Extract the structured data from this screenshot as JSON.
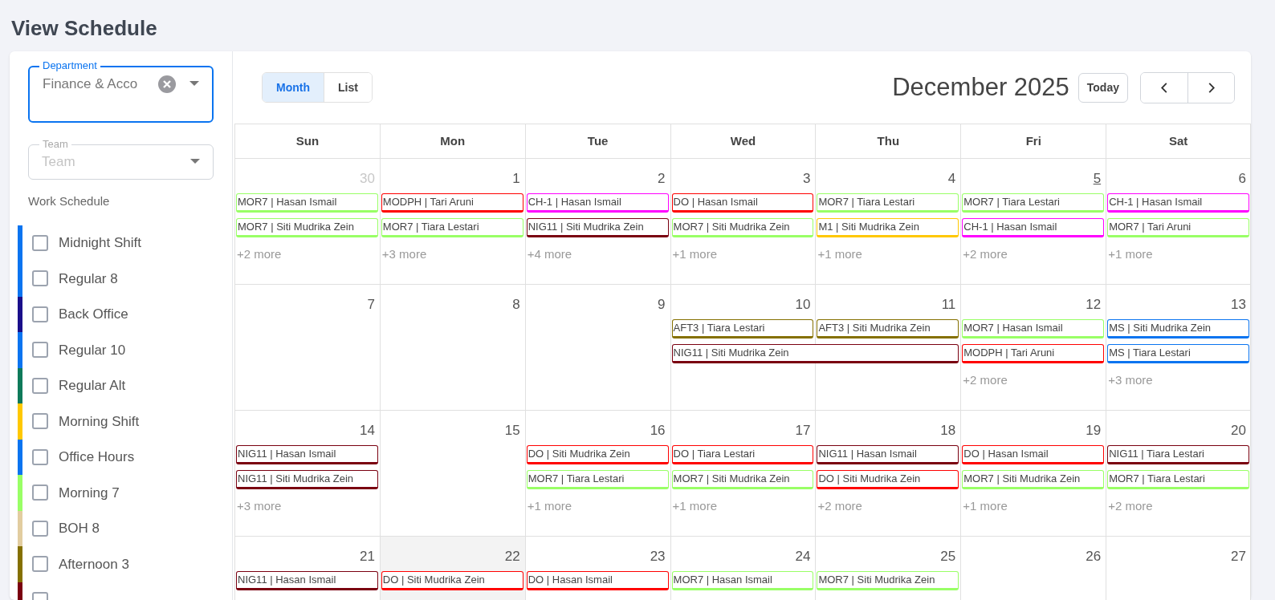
{
  "page_title": "View Schedule",
  "filters": {
    "department": {
      "label": "Department",
      "value": "Finance & Acco"
    },
    "team": {
      "label": "Team",
      "placeholder": "Team"
    },
    "work_schedule_label": "Work Schedule"
  },
  "schedules": [
    {
      "label": "Midnight Shift",
      "color": "#0a74f0",
      "checked": false
    },
    {
      "label": "Regular 8",
      "color": "#0a74f0",
      "checked": false
    },
    {
      "label": "Back Office",
      "color": "#1a0f8a",
      "checked": false
    },
    {
      "label": "Regular 10",
      "color": "#0a74f0",
      "checked": false
    },
    {
      "label": "Regular Alt",
      "color": "#0f7a5a",
      "checked": false
    },
    {
      "label": "Morning Shift",
      "color": "#ffc800",
      "checked": false
    },
    {
      "label": "Office Hours",
      "color": "#0a74f0",
      "checked": false
    },
    {
      "label": "Morning 7",
      "color": "#99ff66",
      "checked": false
    },
    {
      "label": "BOH 8",
      "color": "#e2cda0",
      "checked": false
    },
    {
      "label": "Afternoon 3",
      "color": "#857000",
      "checked": false
    },
    {
      "color": "#7a0010",
      "checked": false
    }
  ],
  "view_tabs": [
    {
      "label": "Month",
      "selected": true
    },
    {
      "label": "List",
      "selected": false
    }
  ],
  "calendar_title": "December 2025",
  "today_button": "Today",
  "weekdays": [
    "Sun",
    "Mon",
    "Tue",
    "Wed",
    "Thu",
    "Fri",
    "Sat"
  ],
  "weeks": [
    {
      "days": [
        {
          "date": "30",
          "outside_month": true,
          "today": false,
          "selected": false,
          "more": "+2 more",
          "events": [
            {
              "label": "MOR7 | Hasan Ismail",
              "color": "#99ff66"
            },
            {
              "label": "MOR7 | Siti Mudrika Zein",
              "color": "#99ff66"
            }
          ]
        },
        {
          "date": "1",
          "outside_month": false,
          "today": false,
          "selected": false,
          "more": "+3 more",
          "events": [
            {
              "label": "MODPH | Tari Aruni",
              "color": "#ff0000"
            },
            {
              "label": "MOR7 | Tiara Lestari",
              "color": "#99ff66"
            }
          ]
        },
        {
          "date": "2",
          "outside_month": false,
          "today": false,
          "selected": false,
          "more": "+4 more",
          "events": [
            {
              "label": "CH-1 | Hasan Ismail",
              "color": "#ff00ff"
            },
            {
              "label": "NIG11 | Siti Mudrika Zein",
              "color": "#7a0010"
            }
          ]
        },
        {
          "date": "3",
          "outside_month": false,
          "today": false,
          "selected": false,
          "more": "+1 more",
          "events": [
            {
              "label": "DO | Hasan Ismail",
              "color": "#ff0000"
            },
            {
              "label": "MOR7 | Siti Mudrika Zein",
              "color": "#99ff66"
            }
          ]
        },
        {
          "date": "4",
          "outside_month": false,
          "today": false,
          "selected": false,
          "more": "+1 more",
          "events": [
            {
              "label": "MOR7 | Tiara Lestari",
              "color": "#99ff66"
            },
            {
              "label": "M1 | Siti Mudrika Zein",
              "color": "#ffc800"
            }
          ]
        },
        {
          "date": "5",
          "outside_month": false,
          "today": true,
          "selected": false,
          "more": "+2 more",
          "events": [
            {
              "label": "MOR7 | Tiara Lestari",
              "color": "#99ff66"
            },
            {
              "label": "CH-1 | Hasan Ismail",
              "color": "#ff00ff"
            }
          ]
        },
        {
          "date": "6",
          "outside_month": false,
          "today": false,
          "selected": false,
          "more": "+1 more",
          "events": [
            {
              "label": "CH-1 | Hasan Ismail",
              "color": "#ff00ff"
            },
            {
              "label": "MOR7 | Tari Aruni",
              "color": "#99ff66"
            }
          ]
        }
      ]
    },
    {
      "days": [
        {
          "date": "7",
          "outside_month": false,
          "today": false,
          "selected": false
        },
        {
          "date": "8",
          "outside_month": false,
          "today": false,
          "selected": false
        },
        {
          "date": "9",
          "outside_month": false,
          "today": false,
          "selected": false
        },
        {
          "date": "10",
          "outside_month": false,
          "today": false,
          "selected": false,
          "events": [
            {
              "label": "AFT3 | Tiara Lestari",
              "color": "#857000"
            },
            {
              "label": "NIG11 | Siti Mudrika Zein",
              "color": "#7a0010",
              "continues_next_day": true
            }
          ]
        },
        {
          "date": "11",
          "outside_month": false,
          "today": false,
          "selected": false,
          "events": [
            {
              "label": "AFT3 | Siti Mudrika Zein",
              "color": "#857000"
            }
          ]
        },
        {
          "date": "12",
          "outside_month": false,
          "today": false,
          "selected": false,
          "more": "+2 more",
          "events": [
            {
              "label": "MOR7 | Hasan Ismail",
              "color": "#99ff66"
            },
            {
              "label": "MODPH | Tari Aruni",
              "color": "#ff0000"
            }
          ]
        },
        {
          "date": "13",
          "outside_month": false,
          "today": false,
          "selected": false,
          "more": "+3 more",
          "events": [
            {
              "label": "MS | Siti Mudrika Zein",
              "color": "#0a74f0"
            },
            {
              "label": "MS | Tiara Lestari",
              "color": "#0a74f0"
            }
          ]
        }
      ]
    },
    {
      "days": [
        {
          "date": "14",
          "outside_month": false,
          "today": false,
          "selected": false,
          "more": "+3 more",
          "events": [
            {
              "label": "NIG11 | Hasan Ismail",
              "color": "#7a0010"
            },
            {
              "label": "NIG11 | Siti Mudrika Zein",
              "color": "#7a0010"
            }
          ]
        },
        {
          "date": "15",
          "outside_month": false,
          "today": false,
          "selected": false
        },
        {
          "date": "16",
          "outside_month": false,
          "today": false,
          "selected": false,
          "more": "+1 more",
          "events": [
            {
              "label": "DO | Siti Mudrika Zein",
              "color": "#ff0000"
            },
            {
              "label": "MOR7 | Tiara Lestari",
              "color": "#99ff66"
            }
          ]
        },
        {
          "date": "17",
          "outside_month": false,
          "today": false,
          "selected": false,
          "more": "+1 more",
          "events": [
            {
              "label": "DO | Tiara Lestari",
              "color": "#ff0000"
            },
            {
              "label": "MOR7 | Siti Mudrika Zein",
              "color": "#99ff66"
            }
          ]
        },
        {
          "date": "18",
          "outside_month": false,
          "today": false,
          "selected": false,
          "more": "+2 more",
          "events": [
            {
              "label": "NIG11 | Hasan Ismail",
              "color": "#7a0010"
            },
            {
              "label": "DO | Siti Mudrika Zein",
              "color": "#ff0000"
            }
          ]
        },
        {
          "date": "19",
          "outside_month": false,
          "today": false,
          "selected": false,
          "more": "+1 more",
          "events": [
            {
              "label": "DO | Hasan Ismail",
              "color": "#ff0000"
            },
            {
              "label": "MOR7 | Siti Mudrika Zein",
              "color": "#99ff66"
            }
          ]
        },
        {
          "date": "20",
          "outside_month": false,
          "today": false,
          "selected": false,
          "more": "+2 more",
          "events": [
            {
              "label": "NIG11 | Tiara Lestari",
              "color": "#7a0010"
            },
            {
              "label": "MOR7 | Tiara Lestari",
              "color": "#99ff66"
            }
          ]
        }
      ]
    },
    {
      "days": [
        {
          "date": "21",
          "outside_month": false,
          "today": false,
          "selected": false,
          "events": [
            {
              "label": "NIG11 | Hasan Ismail",
              "color": "#7a0010"
            }
          ]
        },
        {
          "date": "22",
          "outside_month": false,
          "today": false,
          "selected": true,
          "events": [
            {
              "label": "DO | Siti Mudrika Zein",
              "color": "#ff0000"
            }
          ]
        },
        {
          "date": "23",
          "outside_month": false,
          "today": false,
          "selected": false,
          "events": [
            {
              "label": "DO | Hasan Ismail",
              "color": "#ff0000"
            }
          ]
        },
        {
          "date": "24",
          "outside_month": false,
          "today": false,
          "selected": false,
          "events": [
            {
              "label": "MOR7 | Hasan Ismail",
              "color": "#99ff66"
            }
          ]
        },
        {
          "date": "25",
          "outside_month": false,
          "today": false,
          "selected": false,
          "events": [
            {
              "label": "MOR7 | Siti Mudrika Zein",
              "color": "#99ff66"
            }
          ]
        },
        {
          "date": "26",
          "outside_month": false,
          "today": false,
          "selected": false
        },
        {
          "date": "27",
          "outside_month": false,
          "today": false,
          "selected": false
        }
      ]
    }
  ]
}
